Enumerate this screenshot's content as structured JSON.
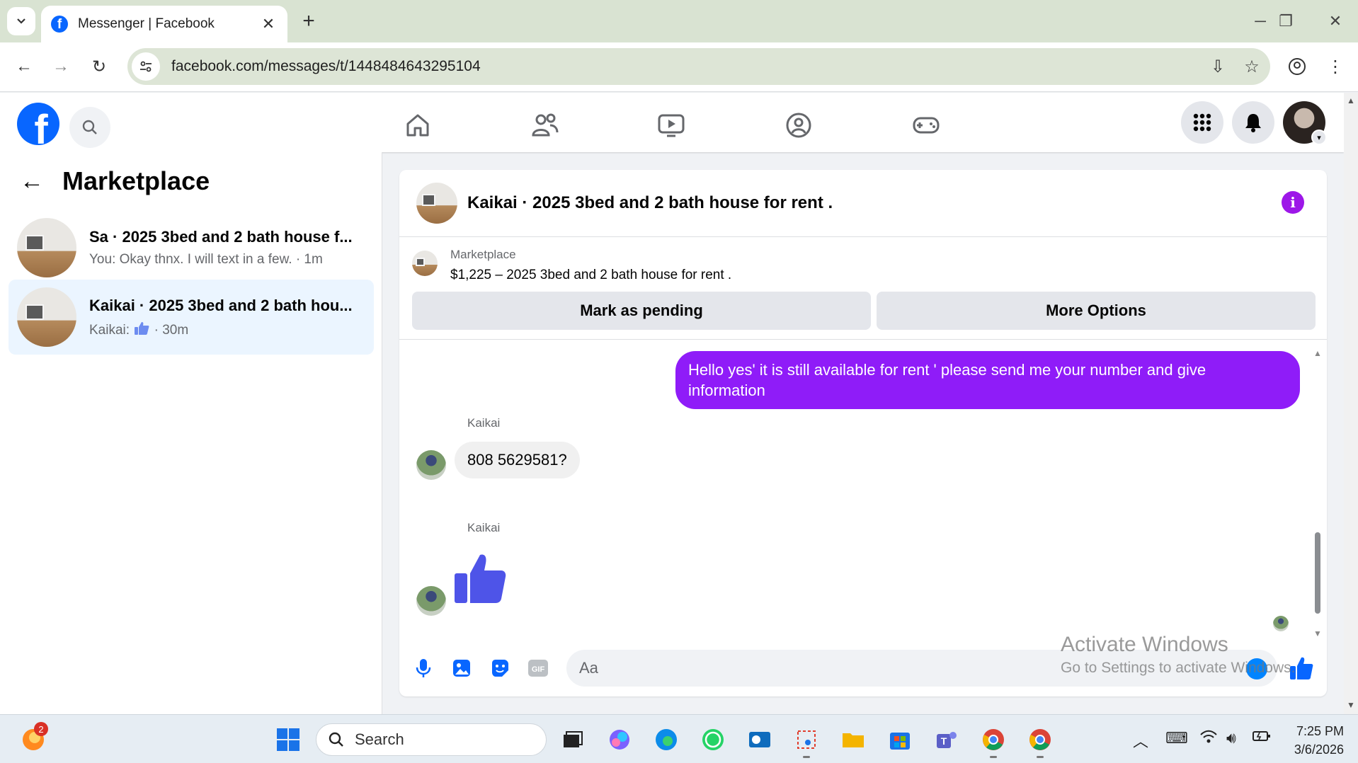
{
  "browser": {
    "tab_title": "Messenger | Facebook",
    "url": "facebook.com/messages/t/1448484643295104",
    "new_tab_label": "+"
  },
  "sidebar": {
    "title": "Marketplace",
    "conversations": [
      {
        "title": "Sa · 2025 3bed and 2 bath house f...",
        "preview": "You: Okay thnx. I will text in a few. · 1m",
        "active": false
      },
      {
        "title": "Kaikai · 2025 3bed and 2 bath hou...",
        "preview_prefix": "Kaikai:",
        "preview_suffix": "· 30m",
        "active": true
      }
    ]
  },
  "chat": {
    "title": "Kaikai · 2025 3bed and 2 bath house for rent .",
    "marketplace_label": "Marketplace",
    "listing": "$1,225 – 2025 3bed and 2 bath house for rent .",
    "buttons": {
      "pending": "Mark as pending",
      "options": "More Options"
    },
    "messages": {
      "outgoing": "Hello yes' it is still available for rent ' please send me your number and give information",
      "sender1": "Kaikai",
      "incoming": "808 5629581?",
      "sender2": "Kaikai"
    },
    "composer_placeholder": "Aa"
  },
  "watermark": {
    "line1": "Activate Windows",
    "line2": "Go to Settings to activate Windows."
  },
  "taskbar": {
    "search_label": "Search",
    "notification_count": "2",
    "time": "7:25 PM",
    "date": "3/6/2026"
  },
  "colors": {
    "facebook_blue": "#0866ff",
    "messenger_purple": "#8f1cf8",
    "active_conversation": "#ebf5ff"
  }
}
